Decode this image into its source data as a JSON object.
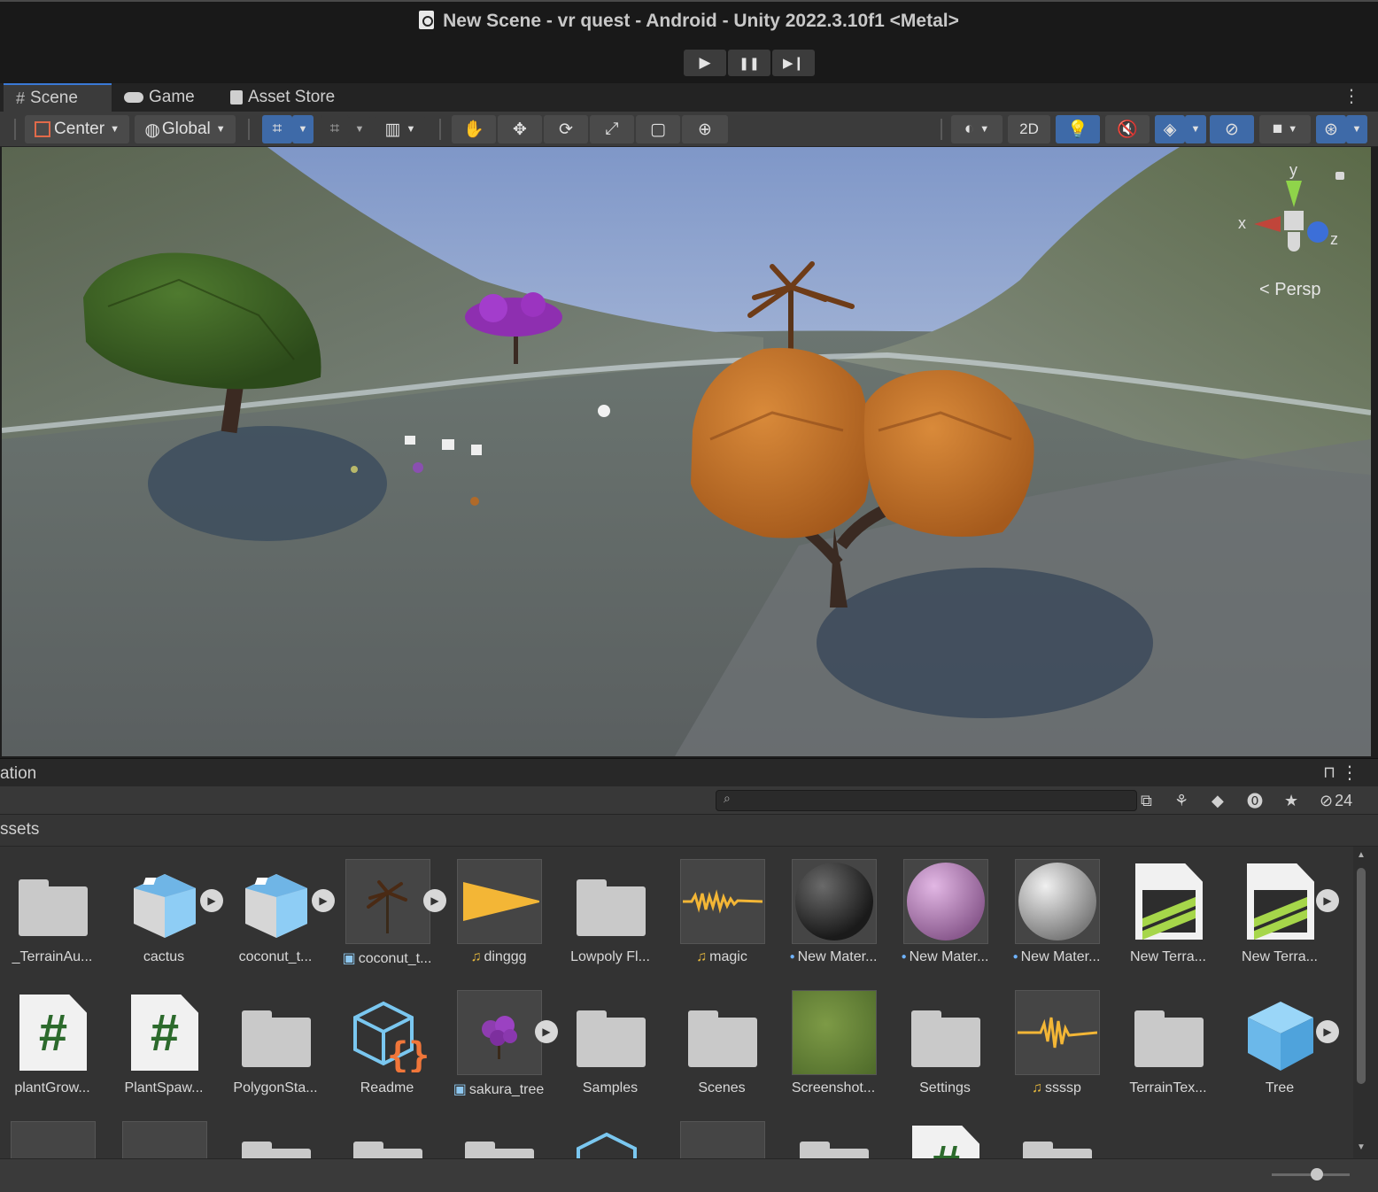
{
  "window": {
    "title": "New Scene - vr quest - Android - Unity 2022.3.10f1 <Metal>"
  },
  "play_controls": {
    "play": "▶",
    "pause": "❚❚",
    "step": "▶❙"
  },
  "tabs": [
    {
      "label": "Scene",
      "icon": "#"
    },
    {
      "label": "Game",
      "icon": "gamepad-icon"
    },
    {
      "label": "Asset Store",
      "icon": "shopping-bag-icon"
    }
  ],
  "scene_toolbar": {
    "pivot": "Center",
    "space": "Global",
    "mode_2d": "2D"
  },
  "gizmo": {
    "x": "x",
    "y": "y",
    "z": "z",
    "projection": "Persp"
  },
  "project": {
    "panel_label": "ation",
    "breadcrumb": "ssets",
    "search_placeholder": "",
    "hidden_count": "24"
  },
  "assets_row1": [
    {
      "name": "_TerrainAu...",
      "type": "folder",
      "prefix": ""
    },
    {
      "name": "cactus",
      "type": "prefab",
      "prefix": ""
    },
    {
      "name": "coconut_t...",
      "type": "prefab",
      "prefix": ""
    },
    {
      "name": "coconut_t...",
      "type": "model-palm",
      "prefix": "▣"
    },
    {
      "name": "dinggg",
      "type": "audio",
      "prefix": "♫"
    },
    {
      "name": "Lowpoly Fl...",
      "type": "folder",
      "prefix": ""
    },
    {
      "name": "magic",
      "type": "audio2",
      "prefix": "♫"
    },
    {
      "name": "New Mater...",
      "type": "material-dark",
      "prefix": "●"
    },
    {
      "name": "New Mater...",
      "type": "material-pink",
      "prefix": "●"
    },
    {
      "name": "New Mater...",
      "type": "material-grey",
      "prefix": "●"
    },
    {
      "name": "New Terra...",
      "type": "terrain",
      "prefix": ""
    },
    {
      "name": "New Terra...",
      "type": "terrain",
      "prefix": ""
    }
  ],
  "assets_row2": [
    {
      "name": "plantGrow...",
      "type": "script",
      "prefix": ""
    },
    {
      "name": "PlantSpaw...",
      "type": "script",
      "prefix": ""
    },
    {
      "name": "PolygonSta...",
      "type": "folder",
      "prefix": ""
    },
    {
      "name": "Readme",
      "type": "readme",
      "prefix": ""
    },
    {
      "name": "sakura_tree",
      "type": "model-sakura",
      "prefix": "▣"
    },
    {
      "name": "Samples",
      "type": "folder",
      "prefix": ""
    },
    {
      "name": "Scenes",
      "type": "folder",
      "prefix": ""
    },
    {
      "name": "Screenshot...",
      "type": "grass",
      "prefix": ""
    },
    {
      "name": "Settings",
      "type": "folder",
      "prefix": ""
    },
    {
      "name": "ssssp",
      "type": "audio3",
      "prefix": "♫"
    },
    {
      "name": "TerrainTex...",
      "type": "folder",
      "prefix": ""
    },
    {
      "name": "Tree",
      "type": "cube",
      "prefix": ""
    }
  ]
}
